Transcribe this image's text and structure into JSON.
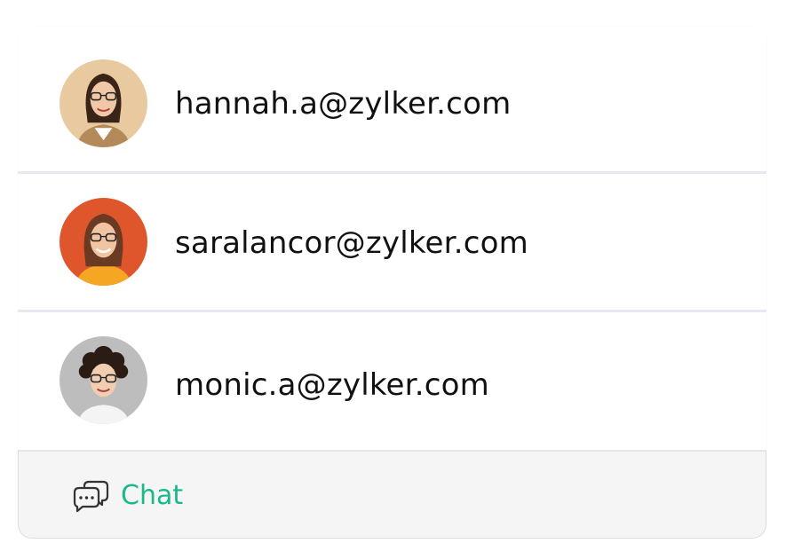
{
  "contacts": [
    {
      "email": "hannah.a@zylker.com",
      "avatar": "hannah-avatar",
      "avatar_bg": "#e9c9a0"
    },
    {
      "email": "saralancor@zylker.com",
      "avatar": "sara-avatar",
      "avatar_bg": "#e0562c"
    },
    {
      "email": "monic.a@zylker.com",
      "avatar": "monic-avatar",
      "avatar_bg": "#bdbdbd"
    }
  ],
  "chat": {
    "label": "Chat",
    "icon": "chat-bubbles-icon",
    "accent_color": "#1bb88a"
  }
}
